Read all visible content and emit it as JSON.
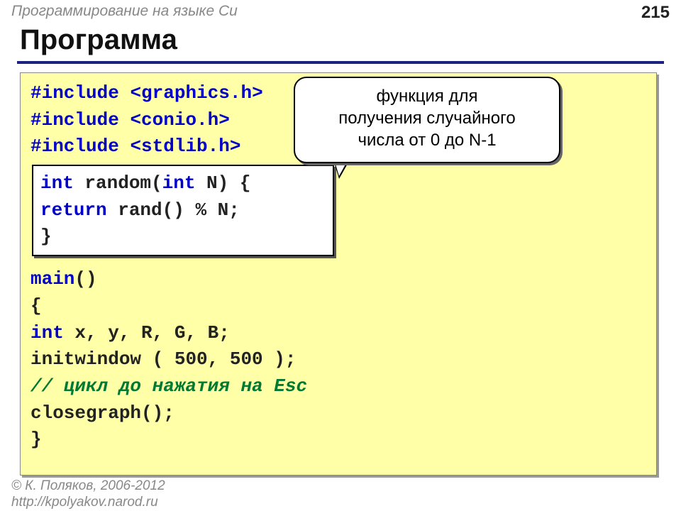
{
  "header": {
    "course": "Программирование на языке Си",
    "page": "215"
  },
  "title": "Программа",
  "code": {
    "inc1_kw": "#include ",
    "inc1_arg": "<graphics.h>",
    "inc2_kw": "#include ",
    "inc2_arg": "<conio.h>",
    "inc3_kw": "#include ",
    "inc3_arg": "<stdlib.h>",
    "rand_l1_a": "int",
    "rand_l1_b": " random(",
    "rand_l1_c": "int",
    "rand_l1_d": " N) {",
    "rand_l2_a": "  return",
    "rand_l2_b": " rand() % N;",
    "rand_l3": "}",
    "main_kw": "main",
    "main_l1": "()",
    "open_brace": "{",
    "decl_a": " int",
    "decl_b": "  x, y, R, G, B;",
    "init_a": " initwindow",
    "init_b": " ( 500, 500 );",
    "comment": "   // цикл до нажатия на Esc",
    "close_a": " closegraph",
    "close_b": "();",
    "close_brace": "}"
  },
  "callout": {
    "l1": "функция для",
    "l2": "получения случайного",
    "l3": "числа от 0 до N-1"
  },
  "footer": {
    "author": "© К. Поляков, 2006-2012",
    "url": "http://kpolyakov.narod.ru"
  }
}
